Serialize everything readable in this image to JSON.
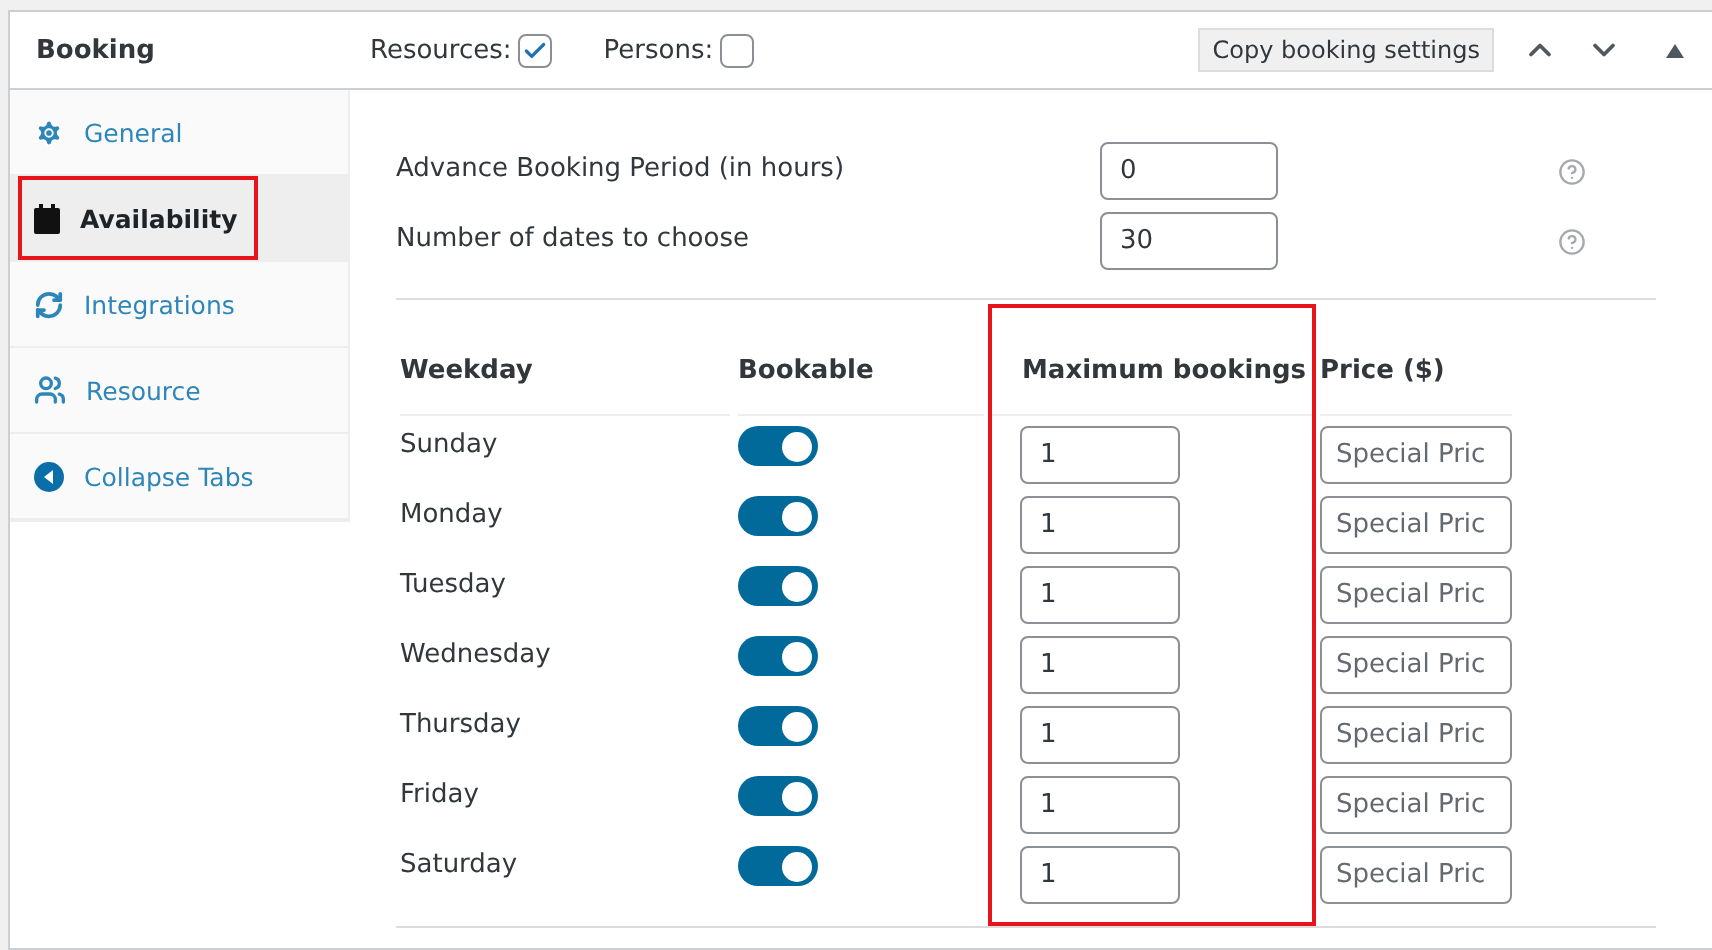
{
  "header": {
    "title": "Booking",
    "options": [
      {
        "label": "Resources:",
        "checked": true
      },
      {
        "label": "Persons:",
        "checked": false
      }
    ],
    "copy_button": "Copy booking settings"
  },
  "tabs": [
    {
      "label": "General",
      "kind": "gear",
      "selected": false,
      "highlighted": false
    },
    {
      "label": "Availability",
      "kind": "calendar",
      "selected": true,
      "highlighted": true
    },
    {
      "label": "Integrations",
      "kind": "sync",
      "selected": false,
      "highlighted": false
    },
    {
      "label": "Resource",
      "kind": "people",
      "selected": false,
      "highlighted": false
    },
    {
      "label": "Collapse Tabs",
      "kind": "collapse",
      "selected": false,
      "highlighted": false
    }
  ],
  "settings": [
    {
      "label": "Advance Booking Period (in hours)",
      "value": "0"
    },
    {
      "label": "Number of dates to choose",
      "value": "30"
    }
  ],
  "table": {
    "columns": [
      {
        "label": "Weekday",
        "highlighted": false
      },
      {
        "label": "Bookable",
        "highlighted": false
      },
      {
        "label": "Maximum bookings",
        "highlighted": true
      },
      {
        "label": "Price ($)",
        "highlighted": false
      }
    ],
    "rows": [
      {
        "day": "Sunday",
        "bookable": true,
        "max": "1",
        "price_placeholder": "Special Pric"
      },
      {
        "day": "Monday",
        "bookable": true,
        "max": "1",
        "price_placeholder": "Special Pric"
      },
      {
        "day": "Tuesday",
        "bookable": true,
        "max": "1",
        "price_placeholder": "Special Pric"
      },
      {
        "day": "Wednesday",
        "bookable": true,
        "max": "1",
        "price_placeholder": "Special Pric"
      },
      {
        "day": "Thursday",
        "bookable": true,
        "max": "1",
        "price_placeholder": "Special Pric"
      },
      {
        "day": "Friday",
        "bookable": true,
        "max": "1",
        "price_placeholder": "Special Pric"
      },
      {
        "day": "Saturday",
        "bookable": true,
        "max": "1",
        "price_placeholder": "Special Pric"
      }
    ]
  }
}
